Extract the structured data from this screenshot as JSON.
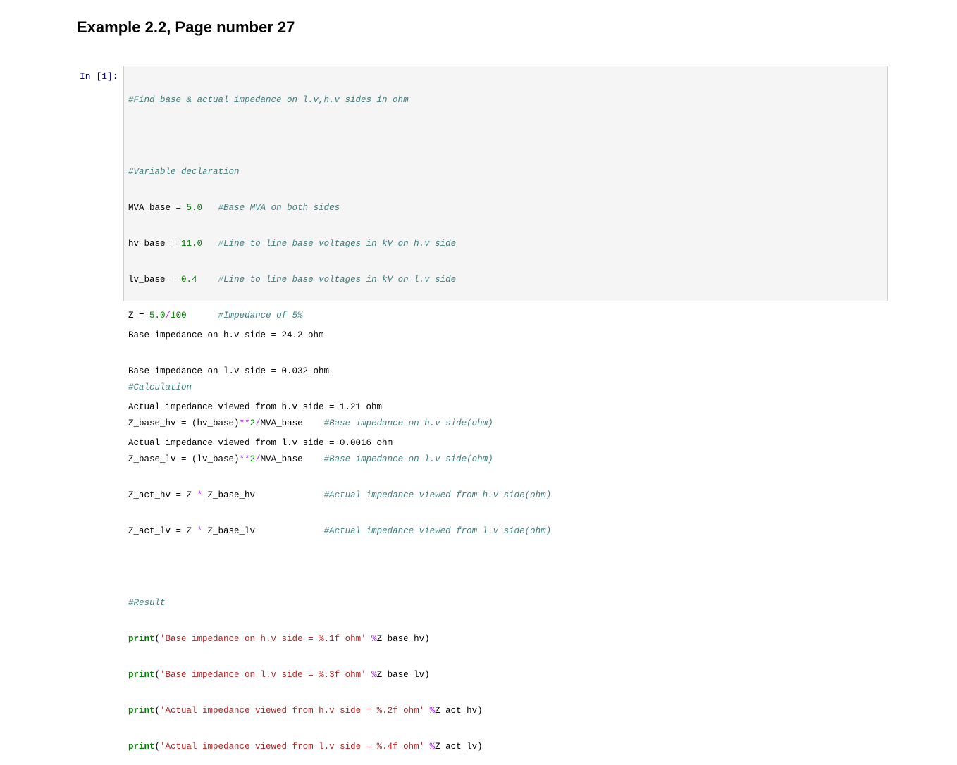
{
  "title": "Example 2.2, Page number 27",
  "prompt": "In [1]:",
  "code": {
    "l1": "#Find base & actual impedance on l.v,h.v sides in ohm",
    "l3": "#Variable declaration",
    "l4": {
      "var": "MVA_base",
      "op": " = ",
      "num": "5.0",
      "pad": "   ",
      "cmt": "#Base MVA on both sides"
    },
    "l5": {
      "var": "hv_base",
      "op": " = ",
      "num": "11.0",
      "pad": "   ",
      "cmt": "#Line to line base voltages in kV on h.v side"
    },
    "l6": {
      "var": "lv_base",
      "op": " = ",
      "num": "0.4",
      "pad": "    ",
      "cmt": "#Line to line base voltages in kV on l.v side"
    },
    "l7": {
      "var": "Z",
      "op": " = ",
      "num": "5.0",
      "slash": "/",
      "num2": "100",
      "pad": "      ",
      "cmt": "#Impedance of 5%"
    },
    "l9": "#Calculation",
    "l10": {
      "a": "Z_base_hv = (hv_base)",
      "op": "**",
      "num": "2",
      "op2": "/",
      "b": "MVA_base",
      "pad": "    ",
      "cmt": "#Base impedance on h.v side(ohm)"
    },
    "l11": {
      "a": "Z_base_lv = (lv_base)",
      "op": "**",
      "num": "2",
      "op2": "/",
      "b": "MVA_base",
      "pad": "    ",
      "cmt": "#Base impedance on l.v side(ohm)"
    },
    "l12": {
      "a": "Z_act_hv = Z ",
      "op": "*",
      "b": " Z_base_hv",
      "pad": "             ",
      "cmt": "#Actual impedance viewed from h.v side(ohm)"
    },
    "l13": {
      "a": "Z_act_lv = Z ",
      "op": "*",
      "b": " Z_base_lv",
      "pad": "             ",
      "cmt": "#Actual impedance viewed from l.v side(ohm)"
    },
    "l15": "#Result",
    "l16": {
      "kw": "print",
      "p1": "(",
      "str": "'Base impedance on h.v side = %.1f ohm'",
      "sp": " ",
      "op": "%",
      "rest": "Z_base_hv)"
    },
    "l17": {
      "kw": "print",
      "p1": "(",
      "str": "'Base impedance on l.v side = %.3f ohm'",
      "sp": " ",
      "op": "%",
      "rest": "Z_base_lv)"
    },
    "l18": {
      "kw": "print",
      "p1": "(",
      "str": "'Actual impedance viewed from h.v side = %.2f ohm'",
      "sp": " ",
      "op": "%",
      "rest": "Z_act_hv)"
    },
    "l19": {
      "kw": "print",
      "p1": "(",
      "str": "'Actual impedance viewed from l.v side = %.4f ohm'",
      "sp": " ",
      "op": "%",
      "rest": "Z_act_lv)"
    }
  },
  "output": [
    "Base impedance on h.v side = 24.2 ohm",
    "Base impedance on l.v side = 0.032 ohm",
    "Actual impedance viewed from h.v side = 1.21 ohm",
    "Actual impedance viewed from l.v side = 0.0016 ohm"
  ]
}
